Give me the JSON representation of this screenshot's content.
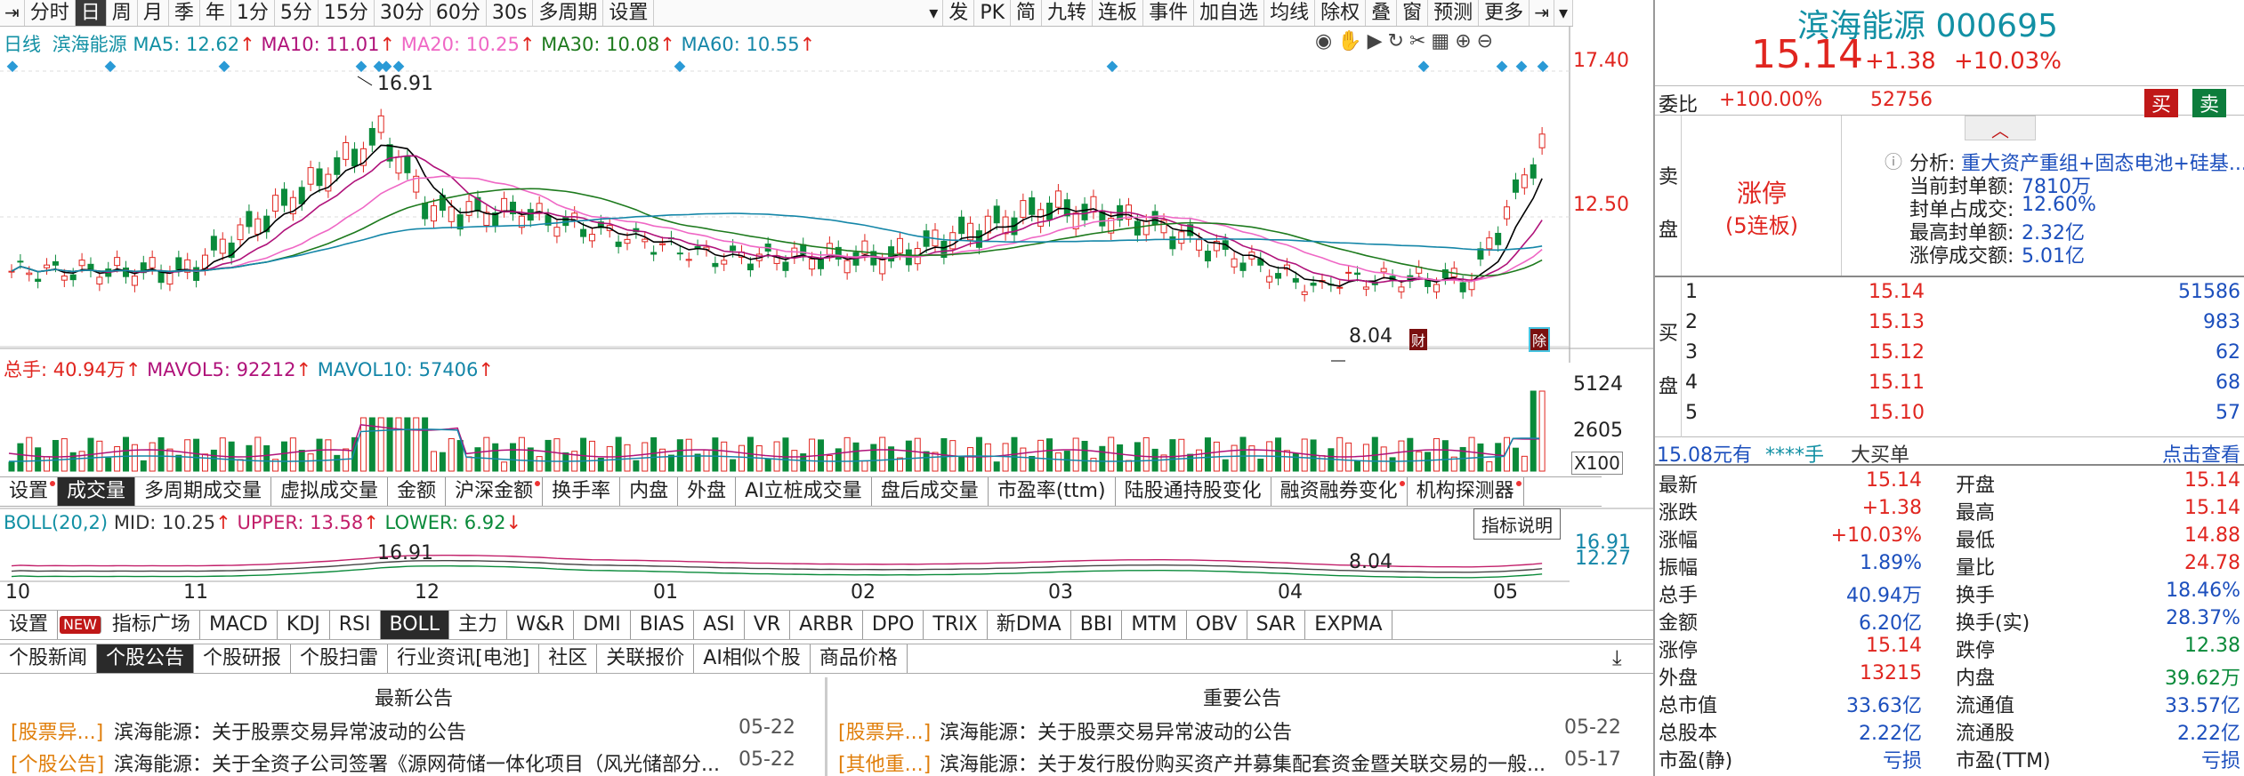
{
  "toolbar": {
    "left": [
      "分时",
      "日",
      "周",
      "月",
      "季",
      "年",
      "1分",
      "5分",
      "15分",
      "30分",
      "60分",
      "30s",
      "多周期",
      "设置"
    ],
    "selected": "日",
    "right": [
      "发",
      "PK",
      "简",
      "九转",
      "连板",
      "事件",
      "加自选",
      "均线",
      "除权",
      "叠",
      "窗",
      "预测",
      "更多"
    ]
  },
  "kline": {
    "legend_period": "日线",
    "legend_name": "滨海能源",
    "ma5": "MA5: 12.62",
    "ma10": "MA10: 11.01",
    "ma20": "MA20: 10.25",
    "ma30": "MA30: 10.08",
    "ma60": "MA60: 10.55",
    "price_hi": "17.40",
    "price_mid": "12.50",
    "high_label": "16.91",
    "low_label": "8.04",
    "tag1": "财",
    "tag2": "除",
    "colors": {
      "ma5": "#000000",
      "ma10": "#b0127a",
      "ma20": "#ef67c5",
      "ma30": "#1d7a1d",
      "ma60": "#1486a8",
      "up": "#e0251f",
      "down": "#0a8a3a",
      "diamond": "#2a9ad6"
    }
  },
  "volume": {
    "total": "总手: 40.94万",
    "mavol5": "MAVOL5: 92212",
    "mavol10": "MAVOL10: 57406",
    "axis_hi": "5124",
    "axis_mid": "2605",
    "unit": "X100"
  },
  "indicator_tabs": [
    "设置",
    "成交量",
    "多周期成交量",
    "虚拟成交量",
    "金额",
    "沪深金额",
    "换手率",
    "内盘",
    "外盘",
    "AI立桩成交量",
    "盘后成交量",
    "市盈率(ttm)",
    "陆股通持股变化",
    "融资融券变化",
    "机构探测器"
  ],
  "indicator_selected": "成交量",
  "boll": {
    "title": "BOLL(20,2)",
    "mid": "MID: 10.25",
    "upper": "UPPER: 13.58",
    "lower": "LOWER: 6.92",
    "hi_label": "16.91",
    "lo_label": "8.04",
    "axis1": "16.91",
    "axis2": "12.27",
    "note": "指标说明"
  },
  "months": [
    "10",
    "11",
    "12",
    "01",
    "02",
    "03",
    "04",
    "05"
  ],
  "indicators": [
    "设置",
    "NEW",
    "指标广场",
    "MACD",
    "KDJ",
    "RSI",
    "BOLL",
    "主力",
    "W&R",
    "DMI",
    "BIAS",
    "ASI",
    "VR",
    "ARBR",
    "DPO",
    "TRIX",
    "新DMA",
    "BBI",
    "MTM",
    "OBV",
    "SAR",
    "EXPMA"
  ],
  "indicators_selected": "BOLL",
  "news_tabs": [
    "个股新闻",
    "个股公告",
    "个股研报",
    "个股扫雷",
    "行业资讯[电池]",
    "社区",
    "关联报价",
    "AI相似个股",
    "商品价格"
  ],
  "news_tabs_selected": "个股公告",
  "news_left": {
    "title": "最新公告",
    "items": [
      {
        "tag": "[股票异...]",
        "text": "滨海能源：关于股票交易异常波动的公告",
        "date": "05-22"
      },
      {
        "tag": "[个股公告]",
        "text": "滨海能源：关于全资子公司签署《源网荷储一体化项目（风光储部分...",
        "date": "05-22"
      }
    ]
  },
  "news_right": {
    "title": "重要公告",
    "items": [
      {
        "tag": "[股票异...]",
        "text": "滨海能源：关于股票交易异常波动的公告",
        "date": "05-22"
      },
      {
        "tag": "[其他重...]",
        "text": "滨海能源：关于发行股份购买资产并募集配套资金暨关联交易的一般...",
        "date": "05-17"
      }
    ]
  },
  "quote": {
    "name": "滨海能源",
    "code": "000695",
    "price": "15.14",
    "change": "+1.38",
    "pct": "+10.03%",
    "weibi_label": "委比",
    "weibi": "+100.00%",
    "weicha": "52756",
    "buy_btn": "买",
    "sell_btn": "卖",
    "sell_side": "卖盘",
    "buy_side": "买盘",
    "limit_status": "涨停",
    "limit_days": "(5连板)",
    "analysis_label": "分析:",
    "analysis": "重大资产重组+固态电池+硅基...",
    "limit_info": [
      {
        "label": "当前封单额:",
        "value": "7810万"
      },
      {
        "label": "封单占成交:",
        "value": "12.60%"
      },
      {
        "label": "最高封单额:",
        "value": "2.32亿"
      },
      {
        "label": "涨停成交额:",
        "value": "5.01亿"
      }
    ],
    "bids": [
      {
        "lvl": "1",
        "price": "15.14",
        "vol": "51586"
      },
      {
        "lvl": "2",
        "price": "15.13",
        "vol": "983"
      },
      {
        "lvl": "3",
        "price": "15.12",
        "vol": "62"
      },
      {
        "lvl": "4",
        "price": "15.11",
        "vol": "68"
      },
      {
        "lvl": "5",
        "price": "15.10",
        "vol": "57"
      }
    ],
    "bigbuy_price": "15.08元有",
    "bigbuy_hands": "****手",
    "bigbuy_label": "大买单",
    "click_view": "点击查看",
    "stats": [
      {
        "l1": "最新",
        "v1": "15.14",
        "c1": "red",
        "l2": "开盘",
        "v2": "15.14",
        "c2": "red"
      },
      {
        "l1": "涨跌",
        "v1": "+1.38",
        "c1": "red",
        "l2": "最高",
        "v2": "15.14",
        "c2": "red"
      },
      {
        "l1": "涨幅",
        "v1": "+10.03%",
        "c1": "red",
        "l2": "最低",
        "v2": "14.88",
        "c2": "red"
      },
      {
        "l1": "振幅",
        "v1": "1.89%",
        "c1": "blue",
        "l2": "量比",
        "v2": "24.78",
        "c2": "red"
      },
      {
        "l1": "总手",
        "v1": "40.94万",
        "c1": "blue",
        "l2": "换手",
        "v2": "18.46%",
        "c2": "blue"
      },
      {
        "l1": "金额",
        "v1": "6.20亿",
        "c1": "blue",
        "l2": "换手(实)",
        "v2": "28.37%",
        "c2": "blue"
      },
      {
        "l1": "涨停",
        "v1": "15.14",
        "c1": "red",
        "l2": "跌停",
        "v2": "12.38",
        "c2": "green"
      },
      {
        "l1": "外盘",
        "v1": "13215",
        "c1": "red",
        "l2": "内盘",
        "v2": "39.62万",
        "c2": "green"
      },
      {
        "l1": "总市值",
        "v1": "33.63亿",
        "c1": "blue",
        "l2": "流通值",
        "v2": "33.57亿",
        "c2": "blue"
      },
      {
        "l1": "总股本",
        "v1": "2.22亿",
        "c1": "blue",
        "l2": "流通股",
        "v2": "2.22亿",
        "c2": "blue"
      },
      {
        "l1": "市盈(静)",
        "v1": "亏损",
        "c1": "blue",
        "l2": "市盈(TTM)",
        "v2": "亏损",
        "c2": "blue"
      }
    ]
  }
}
